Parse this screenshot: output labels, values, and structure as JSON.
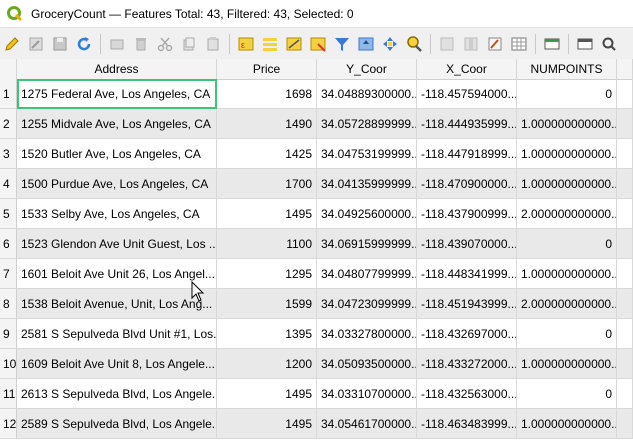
{
  "window": {
    "title": "GroceryCount — Features Total: 43, Filtered: 43, Selected: 0"
  },
  "toolbar": {
    "icons": [
      "pencil-icon",
      "edit-multi-icon",
      "save-icon",
      "reload-icon",
      "sep",
      "add-feature-icon",
      "delete-icon",
      "cut-icon",
      "copy-icon",
      "paste-icon",
      "sep",
      "expression-select-icon",
      "select-all-icon",
      "invert-select-icon",
      "deselect-icon",
      "filter-icon",
      "move-top-icon",
      "pan-icon",
      "zoom-icon",
      "sep",
      "new-field-icon",
      "delete-field-icon",
      "field-calc-icon",
      "conditional-format-icon",
      "sep",
      "dock-icon",
      "sep",
      "actions-icon",
      "search-settings-icon"
    ]
  },
  "table": {
    "columns": [
      "Address",
      "Price",
      "Y_Coor",
      "X_Coor",
      "NUMPOINTS"
    ],
    "rows": [
      {
        "n": "1",
        "address": "1275 Federal Ave, Los Angeles, CA",
        "price": "1698",
        "y": "34.04889300000...",
        "x": "-118.457594000...",
        "np": "0"
      },
      {
        "n": "2",
        "address": "1255 Midvale Ave, Los Angeles, CA",
        "price": "1490",
        "y": "34.05728899999...",
        "x": "-118.444935999...",
        "np": "1.000000000000..."
      },
      {
        "n": "3",
        "address": "1520 Butler Ave, Los Angeles, CA",
        "price": "1425",
        "y": "34.04753199999...",
        "x": "-118.447918999...",
        "np": "1.000000000000..."
      },
      {
        "n": "4",
        "address": "1500 Purdue Ave, Los Angeles, CA",
        "price": "1700",
        "y": "34.04135999999...",
        "x": "-118.470900000...",
        "np": "1.000000000000..."
      },
      {
        "n": "5",
        "address": "1533 Selby Ave, Los Angeles, CA",
        "price": "1495",
        "y": "34.04925600000...",
        "x": "-118.437900999...",
        "np": "2.000000000000..."
      },
      {
        "n": "6",
        "address": "1523 Glendon Ave Unit Guest, Los ...",
        "price": "1100",
        "y": "34.06915999999...",
        "x": "-118.439070000...",
        "np": "0"
      },
      {
        "n": "7",
        "address": "1601 Beloit Ave Unit 26, Los Angel...",
        "price": "1295",
        "y": "34.04807799999...",
        "x": "-118.448341999...",
        "np": "1.000000000000..."
      },
      {
        "n": "8",
        "address": "1538 Beloit Avenue, Unit, Los Ang...",
        "price": "1599",
        "y": "34.04723099999...",
        "x": "-118.451943999...",
        "np": "2.000000000000..."
      },
      {
        "n": "9",
        "address": "2581 S Sepulveda Blvd Unit #1, Los...",
        "price": "1395",
        "y": "34.03327800000...",
        "x": "-118.432697000...",
        "np": "0"
      },
      {
        "n": "10",
        "address": "1609 Beloit Ave Unit 8, Los Angele...",
        "price": "1200",
        "y": "34.05093500000...",
        "x": "-118.433272000...",
        "np": "1.000000000000..."
      },
      {
        "n": "11",
        "address": "2613 S Sepulveda Blvd, Los Angele...",
        "price": "1495",
        "y": "34.03310700000...",
        "x": "-118.432563000...",
        "np": "0"
      },
      {
        "n": "12",
        "address": "2589 S Sepulveda Blvd, Los Angele...",
        "price": "1495",
        "y": "34.05461700000...",
        "x": "-118.463483999...",
        "np": "1.000000000000..."
      }
    ]
  }
}
